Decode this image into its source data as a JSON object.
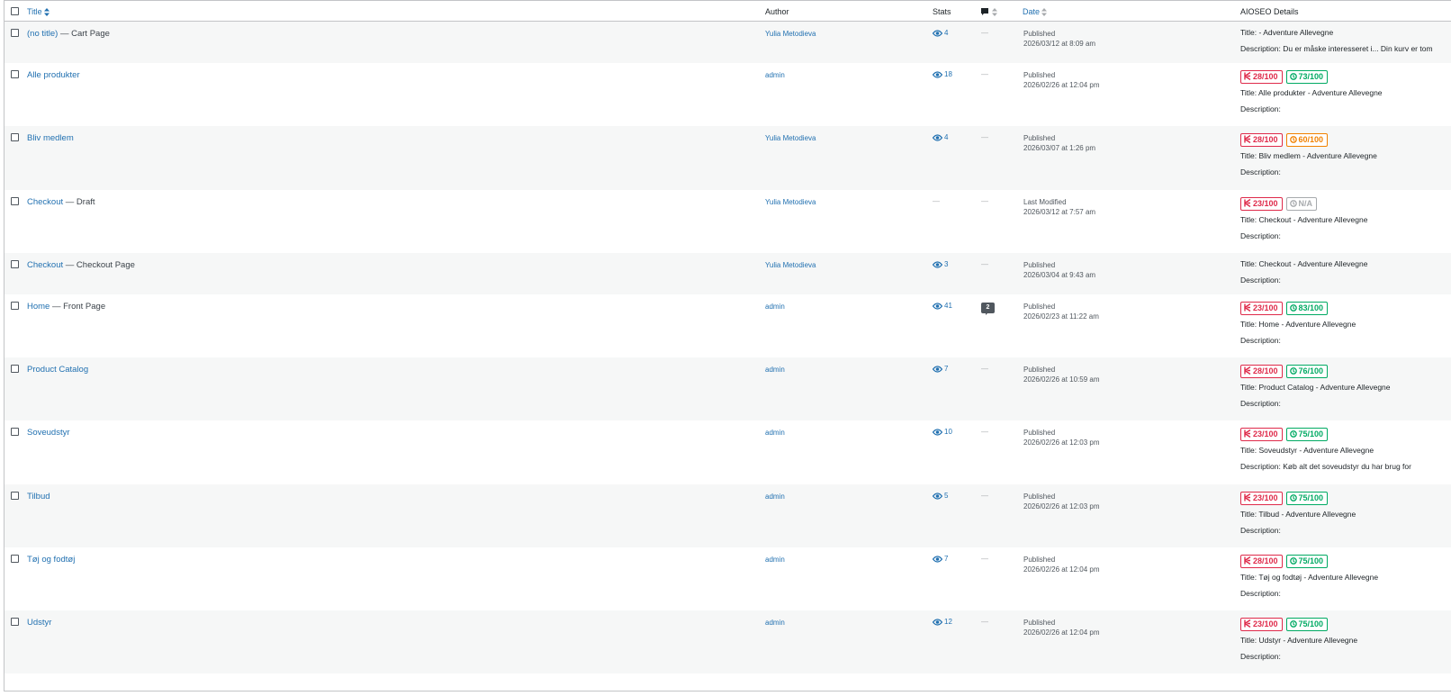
{
  "header": {
    "title": "Title",
    "author": "Author",
    "stats": "Stats",
    "date": "Date",
    "aioseo": "AIOSEO Details"
  },
  "labels": {
    "title_prefix": "Title:",
    "description_prefix": "Description:"
  },
  "colors": {
    "link": "#2271b1",
    "score_red": "#df2a4a",
    "score_green": "#00aa63",
    "score_orange": "#f18200",
    "score_grey": "#a7aaad"
  },
  "rows": [
    {
      "title": "(no title)",
      "state": " — Cart Page",
      "author": "Yulia Metodieva",
      "views": "4",
      "comments": "—",
      "date_status": "Published",
      "date": "2026/03/12 at 8:09 am",
      "scores": [],
      "seo_title": "- Adventure Allevegne",
      "seo_description": "Du er måske interesseret i... Din kurv er tom"
    },
    {
      "title": "Alle produkter",
      "state": "",
      "author": "admin",
      "views": "18",
      "comments": "—",
      "date_status": "Published",
      "date": "2026/02/26 at 12:04 pm",
      "scores": [
        {
          "type": "red",
          "label": "28/100"
        },
        {
          "type": "green",
          "label": "73/100"
        }
      ],
      "seo_title": "Alle produkter - Adventure Allevegne",
      "seo_description": ""
    },
    {
      "title": "Bliv medlem",
      "state": "",
      "author": "Yulia Metodieva",
      "views": "4",
      "comments": "—",
      "date_status": "Published",
      "date": "2026/03/07 at 1:26 pm",
      "scores": [
        {
          "type": "red",
          "label": "28/100"
        },
        {
          "type": "orange",
          "label": "60/100"
        }
      ],
      "seo_title": "Bliv medlem - Adventure Allevegne",
      "seo_description": ""
    },
    {
      "title": "Checkout",
      "state": " — Draft",
      "author": "Yulia Metodieva",
      "views": "",
      "comments": "—",
      "date_status": "Last Modified",
      "date": "2026/03/12 at 7:57 am",
      "scores": [
        {
          "type": "red",
          "label": "23/100"
        },
        {
          "type": "grey",
          "label": "N/A"
        }
      ],
      "seo_title": "Checkout - Adventure Allevegne",
      "seo_description": ""
    },
    {
      "title": "Checkout",
      "state": " — Checkout Page",
      "author": "Yulia Metodieva",
      "views": "3",
      "comments": "—",
      "date_status": "Published",
      "date": "2026/03/04 at 9:43 am",
      "scores": [],
      "seo_title": "Checkout - Adventure Allevegne",
      "seo_description": ""
    },
    {
      "title": "Home",
      "state": " — Front Page",
      "author": "admin",
      "views": "41",
      "comments": "2",
      "date_status": "Published",
      "date": "2026/02/23 at 11:22 am",
      "scores": [
        {
          "type": "red",
          "label": "23/100"
        },
        {
          "type": "green",
          "label": "83/100"
        }
      ],
      "seo_title": "Home - Adventure Allevegne",
      "seo_description": ""
    },
    {
      "title": "Product Catalog",
      "state": "",
      "author": "admin",
      "views": "7",
      "comments": "—",
      "date_status": "Published",
      "date": "2026/02/26 at 10:59 am",
      "scores": [
        {
          "type": "red",
          "label": "28/100"
        },
        {
          "type": "green",
          "label": "76/100"
        }
      ],
      "seo_title": "Product Catalog - Adventure Allevegne",
      "seo_description": ""
    },
    {
      "title": "Soveudstyr",
      "state": "",
      "author": "admin",
      "views": "10",
      "comments": "—",
      "date_status": "Published",
      "date": "2026/02/26 at 12:03 pm",
      "scores": [
        {
          "type": "red",
          "label": "23/100"
        },
        {
          "type": "green",
          "label": "75/100"
        }
      ],
      "seo_title": "Soveudstyr - Adventure Allevegne",
      "seo_description": "Køb alt det soveudstyr du har brug for"
    },
    {
      "title": "Tilbud",
      "state": "",
      "author": "admin",
      "views": "5",
      "comments": "—",
      "date_status": "Published",
      "date": "2026/02/26 at 12:03 pm",
      "scores": [
        {
          "type": "red",
          "label": "23/100"
        },
        {
          "type": "green",
          "label": "75/100"
        }
      ],
      "seo_title": "Tilbud - Adventure Allevegne",
      "seo_description": ""
    },
    {
      "title": "Tøj og fodtøj",
      "state": "",
      "author": "admin",
      "views": "7",
      "comments": "—",
      "date_status": "Published",
      "date": "2026/02/26 at 12:04 pm",
      "scores": [
        {
          "type": "red",
          "label": "28/100"
        },
        {
          "type": "green",
          "label": "75/100"
        }
      ],
      "seo_title": "Tøj og fodtøj - Adventure Allevegne",
      "seo_description": ""
    },
    {
      "title": "Udstyr",
      "state": "",
      "author": "admin",
      "views": "12",
      "comments": "—",
      "date_status": "Published",
      "date": "2026/02/26 at 12:04 pm",
      "scores": [
        {
          "type": "red",
          "label": "23/100"
        },
        {
          "type": "green",
          "label": "75/100"
        }
      ],
      "seo_title": "Udstyr - Adventure Allevegne",
      "seo_description": ""
    }
  ]
}
